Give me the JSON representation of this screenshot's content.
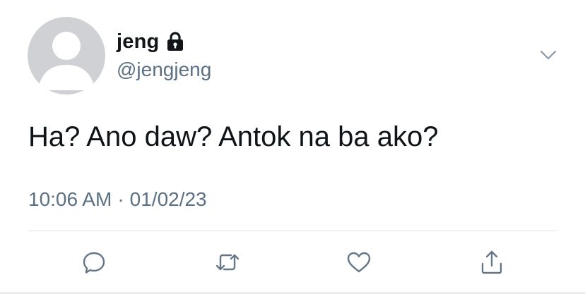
{
  "user": {
    "display_name": "jeng",
    "handle": "@jengjeng",
    "protected_icon": "lock-icon",
    "avatar_icon": "default-avatar-icon"
  },
  "tweet": {
    "text": "Ha? Ano daw? Antok na ba ako?",
    "time": "10:06 AM",
    "separator": "·",
    "date": "01/02/23"
  },
  "actions": [
    {
      "name": "reply",
      "icon": "reply-icon"
    },
    {
      "name": "retweet",
      "icon": "retweet-icon"
    },
    {
      "name": "like",
      "icon": "heart-icon"
    },
    {
      "name": "share",
      "icon": "share-icon"
    }
  ],
  "menu": {
    "icon": "chevron-down-icon"
  },
  "colors": {
    "text_primary": "#0f1419",
    "text_secondary": "#5b7083",
    "avatar_bg": "#cfd1d4",
    "icon_gray": "#657786"
  }
}
